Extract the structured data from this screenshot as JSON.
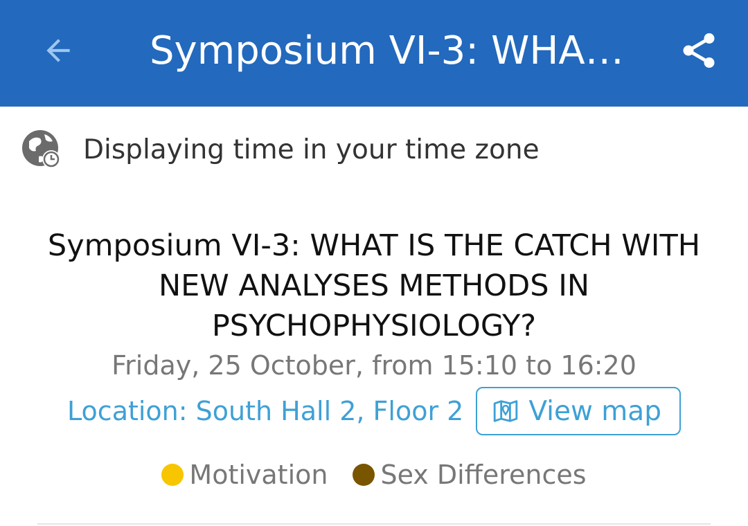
{
  "appbar": {
    "title": "Symposium VI-3: WHA…",
    "background": "#2369bd"
  },
  "icons": {
    "back": "arrow-left-icon",
    "share": "share-icon",
    "timezone": "globe-clock-icon",
    "map": "map-pin-icon"
  },
  "timezone_notice": {
    "text": "Displaying time in your time zone"
  },
  "session": {
    "title": "Symposium VI-3: WHAT IS THE CATCH WITH NEW ANALYSES METHODS IN PSYCHOPHYSIOLOGY?",
    "time": "Friday, 25 October, from 15:10 to 16:20",
    "location": "Location: South Hall 2, Floor 2",
    "view_map_label": "View map"
  },
  "tags": [
    {
      "label": "Motivation",
      "color": "#f7c600"
    },
    {
      "label": "Sex Differences",
      "color": "#7a5500"
    }
  ],
  "colors": {
    "accent": "#3ea0d6"
  }
}
